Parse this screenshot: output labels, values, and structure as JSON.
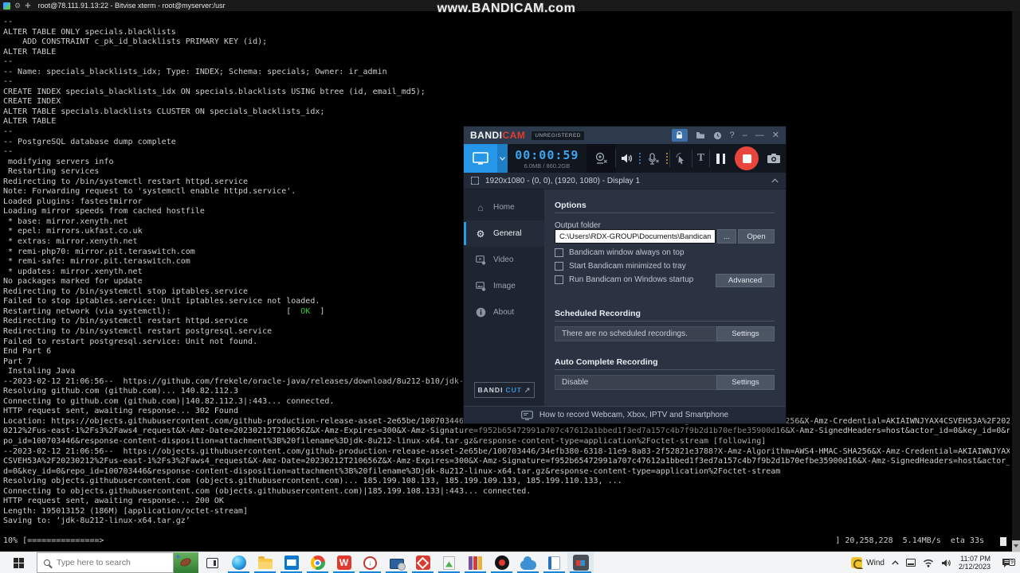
{
  "titlebar": {
    "title": "root@78.111.91.13:22 - Bitvise xterm - root@myserver:/usr"
  },
  "watermark": "www.BANDICAM.com",
  "terminal": {
    "text_color": "#cfcfcf",
    "ok_color": "#35c935",
    "lines": [
      "--",
      "ALTER TABLE ONLY specials.blacklists",
      "    ADD CONSTRAINT c_pk_id_blacklists PRIMARY KEY (id);",
      "ALTER TABLE",
      "--",
      "-- Name: specials_blacklists_idx; Type: INDEX; Schema: specials; Owner: ir_admin",
      "--",
      "CREATE INDEX specials_blacklists_idx ON specials.blacklists USING btree (id, email_md5);",
      "CREATE INDEX",
      "ALTER TABLE specials.blacklists CLUSTER ON specials_blacklists_idx;",
      "ALTER TABLE",
      "--",
      "-- PostgreSQL database dump complete",
      "--",
      " modifying servers info",
      " Restarting services",
      "Redirecting to /bin/systemctl restart httpd.service",
      "Note: Forwarding request to 'systemctl enable httpd.service'.",
      "Loaded plugins: fastestmirror",
      "Loading mirror speeds from cached hostfile",
      " * base: mirror.xenyth.net",
      " * epel: mirrors.ukfast.co.uk",
      " * extras: mirror.xenyth.net",
      " * remi-php70: mirror.pit.teraswitch.com",
      " * remi-safe: mirror.pit.teraswitch.com",
      " * updates: mirror.xenyth.net",
      "No packages marked for update",
      "Redirecting to /bin/systemctl stop iptables.service",
      "Failed to stop iptables.service: Unit iptables.service not loaded.",
      {
        "parts": [
          {
            "t": "Restarting network (via systemctl):                        [  "
          },
          {
            "t": "OK",
            "c": "#35c935"
          },
          {
            "t": "  ]"
          }
        ]
      },
      "Redirecting to /bin/systemctl restart httpd.service",
      "Redirecting to /bin/systemctl restart postgresql.service",
      "Failed to restart postgresql.service: Unit not found.",
      "End Part 6",
      "Part 7",
      " Instaling Java",
      "--2023-02-12 21:06:56--  https://github.com/frekele/oracle-java/releases/download/8u212-b10/jdk-8u212-linux-x64.tar.gz",
      "Resolving github.com (github.com)... 140.82.112.3",
      "Connecting to github.com (github.com)|140.82.112.3|:443... connected.",
      "HTTP request sent, awaiting response... 302 Found",
      "Location: https://objects.githubusercontent.com/github-production-release-asset-2e65be/100703446/34efb380-6318-11e9-8a83-2f52821e3788?X-Amz-Algorithm=AWS4-HMAC-SHA256&X-Amz-Credential=AKIAIWNJYAX4CSVEH53A%2F2023",
      "0212%2Fus-east-1%2Fs3%2Faws4_request&X-Amz-Date=20230212T210656Z&X-Amz-Expires=300&X-Amz-Signature=f952b65472991a707c47612a1bbed1f3ed7a157c4b7f9b2d1b70efbe35900d16&X-Amz-SignedHeaders=host&actor_id=0&key_id=0&re",
      "po_id=100703446&response-content-disposition=attachment%3B%20filename%3Djdk-8u212-linux-x64.tar.gz&response-content-type=application%2Foctet-stream [following]",
      "--2023-02-12 21:06:56--  https://objects.githubusercontent.com/github-production-release-asset-2e65be/100703446/34efb380-6318-11e9-8a83-2f52821e3788?X-Amz-Algorithm=AWS4-HMAC-SHA256&X-Amz-Credential=AKIAIWNJYAX4",
      "CSVEH53A%2F20230212%2Fus-east-1%2Fs3%2Faws4_request&X-Amz-Date=20230212T210656Z&X-Amz-Expires=300&X-Amz-Signature=f952b65472991a707c47612a1bbed1f3ed7a157c4b7f9b2d1b70efbe35900d16&X-Amz-SignedHeaders=host&actor_i",
      "d=0&key_id=0&repo_id=100703446&response-content-disposition=attachment%3B%20filename%3Djdk-8u212-linux-x64.tar.gz&response-content-type=application%2Foctet-stream",
      "Resolving objects.githubusercontent.com (objects.githubusercontent.com)... 185.199.108.133, 185.199.109.133, 185.199.110.133, ...",
      "Connecting to objects.githubusercontent.com (objects.githubusercontent.com)|185.199.108.133|:443... connected.",
      "HTTP request sent, awaiting response... 200 OK",
      "Length: 195013152 (186M) [application/octet-stream]",
      "Saving to: ‘jdk-8u212-linux-x64.tar.gz’",
      ""
    ],
    "progress_left": "10% [===============>",
    "progress_right": "] 20,258,228  5.14MB/s  eta 33s"
  },
  "bandicam": {
    "accent_blue": "#2596e8",
    "record_red": "#e8453c",
    "logo_white": "BANDI",
    "logo_red": "CAM",
    "unregistered": "UNREGISTERED",
    "timer": "00:00:59",
    "storage": "6.0MB / 860.2GB",
    "display_info": "1920x1080 - (0, 0), (1920, 1080) - Display 1",
    "sidebar": [
      {
        "label": "Home"
      },
      {
        "label": "General"
      },
      {
        "label": "Video"
      },
      {
        "label": "Image"
      },
      {
        "label": "About"
      }
    ],
    "bandicut": {
      "white": "BANDI",
      "blue": "CUT",
      "arrow": "↗"
    },
    "general": {
      "section_options": "Options",
      "output_folder_label": "Output folder",
      "output_path": "C:\\Users\\RDX-GROUP\\Documents\\Bandicam",
      "browse_label": "...",
      "open_label": "Open",
      "checkboxes": [
        "Bandicam window always on top",
        "Start Bandicam minimized to tray",
        "Run Bandicam on Windows startup"
      ],
      "advanced_label": "Advanced",
      "section_scheduled": "Scheduled Recording",
      "scheduled_status": "There are no scheduled recordings.",
      "settings_label": "Settings",
      "section_autocomplete": "Auto Complete Recording",
      "autocomplete_status": "Disable",
      "settings_label2": "Settings"
    },
    "footer": "How to record Webcam, Xbox, IPTV and Smartphone"
  },
  "taskbar": {
    "search_placeholder": "Type here to search",
    "app_icons": [
      {
        "name": "edge-icon"
      },
      {
        "name": "file-explorer-icon"
      },
      {
        "name": "mail-icon"
      },
      {
        "name": "chrome-icon"
      },
      {
        "name": "wps-office-icon",
        "glyph": "W"
      },
      {
        "name": "download-manager-icon"
      },
      {
        "name": "remote-desktop-icon"
      },
      {
        "name": "red-diamond-app-icon"
      },
      {
        "name": "image-editor-icon"
      },
      {
        "name": "winrar-icon"
      },
      {
        "name": "screen-recorder-icon"
      },
      {
        "name": "cloud-app-icon"
      },
      {
        "name": "notes-app-icon"
      },
      {
        "name": "bandicam-taskbar-icon",
        "active": true
      }
    ],
    "tray_app_label": "Wind",
    "clock_time": "11:07 PM",
    "clock_date": "2/12/2023",
    "notification_count": "9"
  }
}
